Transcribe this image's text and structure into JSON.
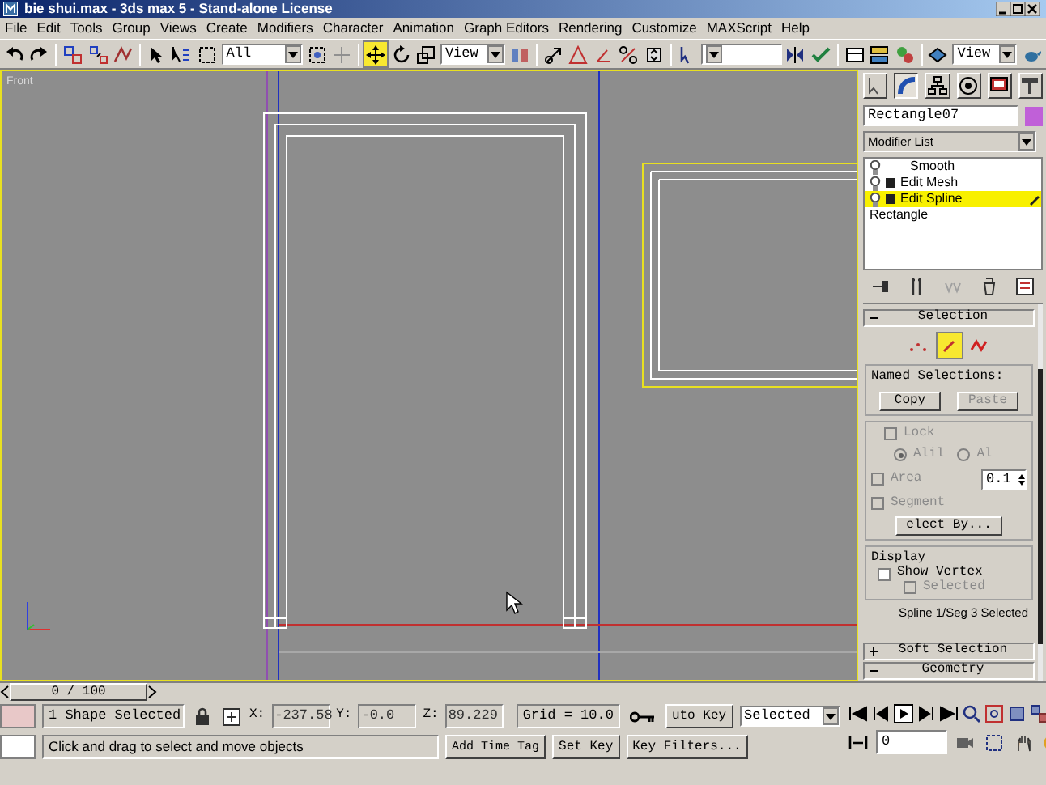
{
  "window": {
    "title": "bie shui.max - 3ds max 5 - Stand-alone License"
  },
  "menu": [
    "File",
    "Edit",
    "Tools",
    "Group",
    "Views",
    "Create",
    "Modifiers",
    "Character",
    "Animation",
    "Graph Editors",
    "Rendering",
    "Customize",
    "MAXScript",
    "Help"
  ],
  "toolbar": {
    "selection_filter": "All",
    "transform_tools": [
      {
        "selected": true
      },
      {
        "selected": false
      },
      {
        "selected": false
      }
    ],
    "reference_coord_system": "View",
    "render_type": "View"
  },
  "viewport": {
    "label": "Front"
  },
  "command_panel": {
    "tabs": [
      {
        "selected": false
      },
      {
        "selected": true
      },
      {
        "selected": false
      },
      {
        "selected": false
      },
      {
        "selected": false
      },
      {
        "selected": false
      }
    ],
    "object": {
      "name": "Rectangle07",
      "color": "#c060d8"
    },
    "modifier_list": "Modifier List",
    "stack": [
      {
        "label": "Smooth",
        "kind": "modifier",
        "selected": false
      },
      {
        "label": "Edit Mesh",
        "kind": "editable",
        "selected": false
      },
      {
        "label": "Edit Spline",
        "kind": "editable",
        "selected": true
      },
      {
        "label": "Rectangle",
        "kind": "base",
        "selected": false
      }
    ],
    "selection_rollout": {
      "title": "Selection",
      "expanded": true,
      "levels": [
        {
          "selected": false
        },
        {
          "selected": true
        },
        {
          "selected": false
        }
      ],
      "named_selections": {
        "title": "Named Selections:",
        "buttons": [
          {
            "label": "Copy",
            "disabled": false
          },
          {
            "label": "Paste",
            "disabled": true
          }
        ]
      },
      "lock": {
        "label": "Lock",
        "checked": false,
        "disabled": true
      },
      "radios": [
        {
          "label": "Alil",
          "selected": true,
          "disabled": true
        },
        {
          "label": "Al",
          "selected": false,
          "disabled": true
        }
      ],
      "area": {
        "label": "Area",
        "checked": false,
        "disabled": true,
        "value": "0.1"
      },
      "segment": {
        "label": "Segment",
        "checked": false,
        "disabled": true
      },
      "select_by": "elect By...",
      "display": {
        "title": "Display",
        "options": [
          {
            "label": "Show Vertex",
            "checked": false,
            "disabled": false
          },
          {
            "label": "Selected",
            "checked": false,
            "disabled": true
          }
        ]
      },
      "status": "Spline 1/Seg 3 Selected"
    },
    "other_rollouts": [
      {
        "title": "Soft Selection",
        "expanded": false
      },
      {
        "title": "Geometry",
        "expanded": true
      }
    ]
  },
  "time_slider": {
    "label": "0 / 100"
  },
  "status_bar": {
    "selection": "1 Shape Selected",
    "coordinates": [
      {
        "axis": "X:",
        "value": "-237.58"
      },
      {
        "axis": "Y:",
        "value": "-0.0"
      },
      {
        "axis": "Z:",
        "value": "89.229"
      }
    ],
    "grid": "Grid = 10.0",
    "auto_key": "uto Key",
    "key_mode": "Selected",
    "prompt": "Click and drag to select and move objects",
    "add_time_tag": "Add Time Tag",
    "set_key": "Set Key",
    "key_filters": "Key Filters...",
    "current_frame": "0"
  }
}
